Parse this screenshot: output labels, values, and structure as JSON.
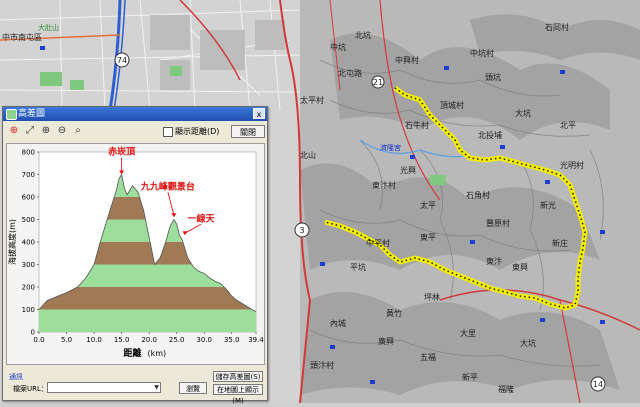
{
  "window": {
    "title": "高差圖",
    "close_x": "x",
    "checkbox_label": "顯示距離(D)",
    "close_button": "關閉",
    "group_label": "通訊",
    "url_label": "檔案URL：",
    "browse_button": "瀏覽",
    "save_profile_button": "儲存高差圖(S)",
    "open_map_button": "在地圖上顯示(M)"
  },
  "toolbar": {
    "icons": [
      "crosshair-icon",
      "pointer-icon",
      "zoom-in-icon",
      "zoom-out-icon",
      "zoom-fit-icon"
    ]
  },
  "map": {
    "labels": [
      {
        "text": "中市南屯區",
        "style": "dark"
      },
      {
        "text": "大肚山",
        "style": "green"
      },
      {
        "text": "中坑",
        "style": "dark"
      },
      {
        "text": "北坑",
        "style": "dark"
      },
      {
        "text": "石岡村",
        "style": "dark"
      },
      {
        "text": "中興村",
        "style": "dark"
      },
      {
        "text": "北屯路",
        "style": "dark"
      },
      {
        "text": "太平村",
        "style": "dark"
      },
      {
        "text": "中坑村",
        "style": "dark"
      },
      {
        "text": "頭坑",
        "style": "dark"
      },
      {
        "text": "石牛村",
        "style": "dark"
      },
      {
        "text": "北投埔",
        "style": "dark"
      },
      {
        "text": "大坑",
        "style": "dark"
      },
      {
        "text": "濟隆宮",
        "style": "blue"
      },
      {
        "text": "光興",
        "style": "dark"
      },
      {
        "text": "東汴村",
        "style": "dark"
      },
      {
        "text": "太平",
        "style": "dark"
      },
      {
        "text": "石角村",
        "style": "dark"
      },
      {
        "text": "豐原村",
        "style": "dark"
      },
      {
        "text": "新光",
        "style": "dark"
      },
      {
        "text": "東平",
        "style": "dark"
      },
      {
        "text": "中平村",
        "style": "dark"
      },
      {
        "text": "平坑",
        "style": "dark"
      },
      {
        "text": "坪林",
        "style": "dark"
      },
      {
        "text": "黃竹",
        "style": "dark"
      },
      {
        "text": "大里",
        "style": "dark"
      },
      {
        "text": "內城",
        "style": "dark"
      },
      {
        "text": "廣興",
        "style": "dark"
      },
      {
        "text": "東汴",
        "style": "dark"
      },
      {
        "text": "新庄",
        "style": "dark"
      },
      {
        "text": "東興",
        "style": "dark"
      },
      {
        "text": "五福",
        "style": "dark"
      },
      {
        "text": "新平",
        "style": "dark"
      },
      {
        "text": "福隆",
        "style": "dark"
      },
      {
        "text": "大坑",
        "style": "dark"
      },
      {
        "text": "北山",
        "style": "dark"
      },
      {
        "text": "光明村",
        "style": "dark"
      },
      {
        "text": "頭汴村",
        "style": "dark"
      },
      {
        "text": "頂城村",
        "style": "dark"
      },
      {
        "text": "北平",
        "style": "dark"
      }
    ],
    "route_shields": [
      "74",
      "3",
      "21",
      "14"
    ]
  },
  "chart_data": {
    "type": "area",
    "xlabel": "距離",
    "xlabel_unit": "(km)",
    "ylabel": "海拔高度(m)",
    "xlim": [
      0,
      39.4
    ],
    "ylim": [
      0,
      800
    ],
    "x_ticks": [
      "0.0",
      "5.0",
      "10.0",
      "15.0",
      "20.0",
      "25.0",
      "30.0",
      "35.0",
      "39.4"
    ],
    "y_ticks": [
      "0",
      "100",
      "200",
      "300",
      "400",
      "500",
      "600",
      "700",
      "800"
    ],
    "band_colors": [
      "#9dde9d",
      "#a07a55"
    ],
    "annotations": [
      {
        "text": "赤崁頂",
        "x": 15.0,
        "y": 700,
        "color": "#e21212"
      },
      {
        "text": "九九峰觀景台",
        "x": 24.5,
        "y": 510,
        "color": "#e21212"
      },
      {
        "text": "一線天",
        "x": 26.5,
        "y": 430,
        "color": "#e21212"
      }
    ],
    "series": [
      {
        "x": [
          0,
          1.5,
          3,
          5,
          7,
          8.5,
          10,
          11,
          12,
          13,
          14,
          14.5,
          15,
          15.5,
          16,
          17,
          18,
          19,
          20,
          21,
          22,
          23,
          23.8,
          24.5,
          25,
          25.5,
          26,
          27,
          28,
          29,
          30,
          31,
          32,
          33,
          34,
          35,
          36,
          37,
          38,
          39.4
        ],
        "y": [
          100,
          140,
          155,
          175,
          200,
          240,
          300,
          390,
          470,
          550,
          625,
          680,
          700,
          640,
          610,
          650,
          620,
          540,
          420,
          300,
          330,
          400,
          470,
          500,
          480,
          430,
          410,
          330,
          290,
          270,
          260,
          240,
          225,
          215,
          190,
          160,
          140,
          125,
          110,
          90
        ]
      }
    ]
  }
}
